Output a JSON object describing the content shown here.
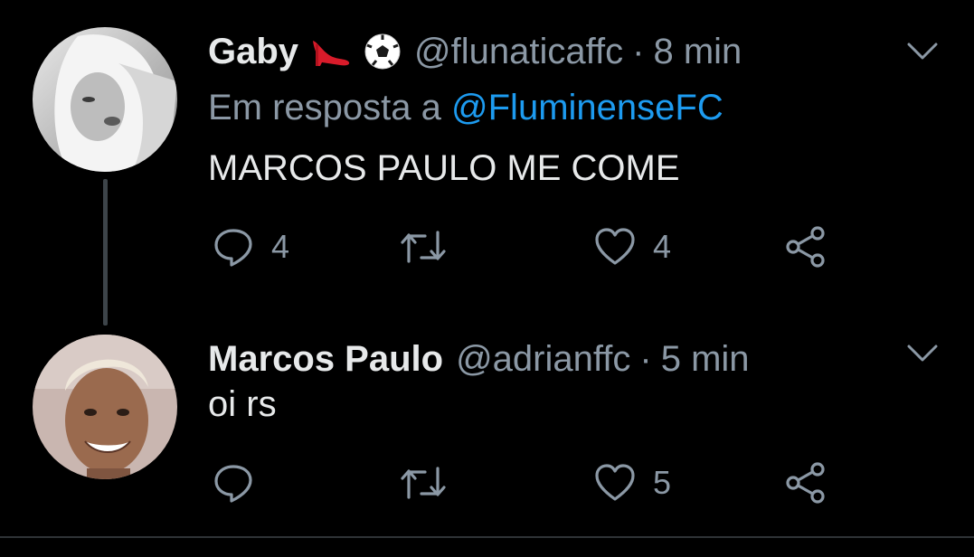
{
  "tweets": [
    {
      "display_name": "Gaby",
      "emojis": [
        "high-heel-icon",
        "soccer-ball-icon"
      ],
      "handle": "@flunaticaffc",
      "separator": "·",
      "time": "8 min",
      "reply_prefix": "Em resposta a",
      "reply_to": "@FluminenseFC",
      "text": "MARCOS PAULO ME COME",
      "replies": "4",
      "retweets": "",
      "likes": "4"
    },
    {
      "display_name": "Marcos Paulo",
      "handle": "@adrianffc",
      "separator": "·",
      "time": "5 min",
      "text": "oi rs",
      "replies": "",
      "retweets": "",
      "likes": "5"
    }
  ],
  "colors": {
    "background": "#000000",
    "text_primary": "#e7e9ea",
    "text_secondary": "#8b98a5",
    "link": "#1d9bf0",
    "thread_line": "#3d4449"
  }
}
